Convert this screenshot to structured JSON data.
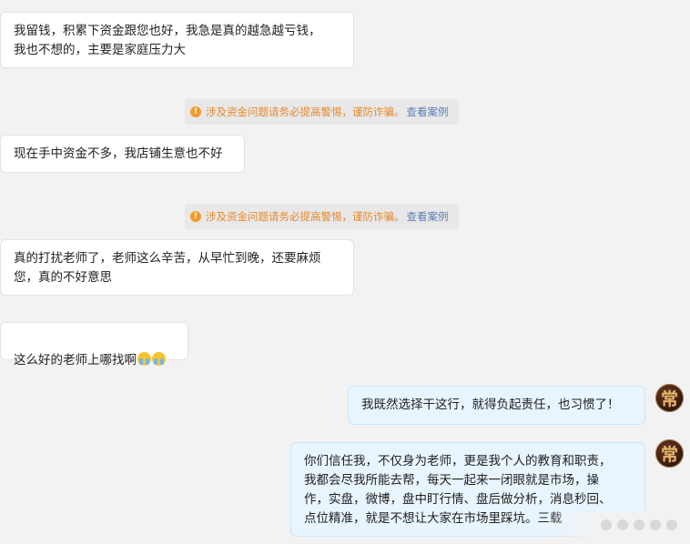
{
  "messages": {
    "m1": "我留钱，积累下资金跟您也好，我急是真的越急越亏钱，\n我也不想的，主要是家庭压力大",
    "m2": "现在手中资金不多，我店铺生意也不好",
    "m3": "真的打扰老师了，老师这么辛苦，从早忙到晚，还要麻烦\n您，真的不好意思",
    "m4": "这么好的老师上哪找啊",
    "m5": "我既然选择干这行，就得负起责任，也习惯了！",
    "m6": "你们信任我，不仅身为老师，更是我个人的教育和职责，\n我都会尽我所能去帮，每天一起来一闭眼就是市场，操\n作，实盘，微博，盘中盯行情、盘后做分析，消息秒回、\n点位精准，就是不想让大家在市场里踩坑。三载"
  },
  "notice": {
    "icon": "!",
    "text": "涉及资金问题请务必提高警惕，谨防诈骗。",
    "link": "查看案例"
  },
  "avatar": {
    "char": "常"
  },
  "colors": {
    "warning": "#e6892a",
    "link": "#5b7fb4",
    "outgoing_bubble": "#e8f4fe"
  }
}
